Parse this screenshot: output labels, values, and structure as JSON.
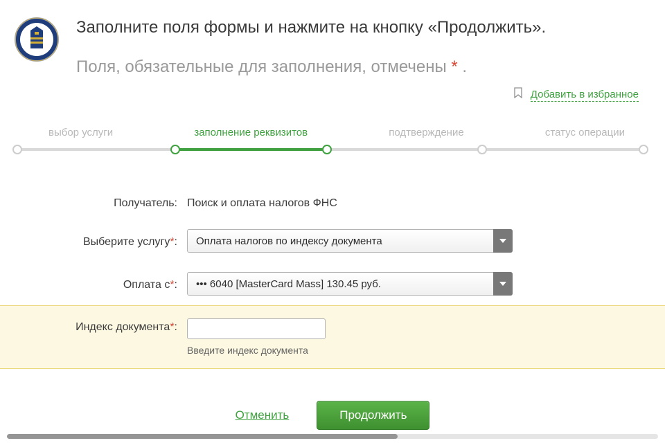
{
  "header": {
    "title": "Заполните поля формы и нажмите на кнопку «Продолжить».",
    "subtitle_prefix": "Поля, обязательные для заполнения, отмечены ",
    "subtitle_suffix": " ."
  },
  "favorites": {
    "label": "Добавить в избранное"
  },
  "steps": {
    "s1": "выбор услуги",
    "s2": "заполнение реквизитов",
    "s3": "подтверждение",
    "s4": "статус операции"
  },
  "form": {
    "recipient": {
      "label": "Получатель:",
      "value": "Поиск и оплата налогов ФНС"
    },
    "service": {
      "label_text": "Выберите услугу",
      "colon": ":",
      "selected": "Оплата налогов по индексу документа"
    },
    "pay_from": {
      "label_text": "Оплата с",
      "colon": ":",
      "selected": "••• 6040 [MasterCard Mass] 130.45 руб."
    },
    "doc_index": {
      "label_text": "Индекс документа",
      "colon": ":",
      "value": "",
      "hint": "Введите индекс документа"
    }
  },
  "buttons": {
    "cancel": "Отменить",
    "continue": "Продолжить"
  }
}
